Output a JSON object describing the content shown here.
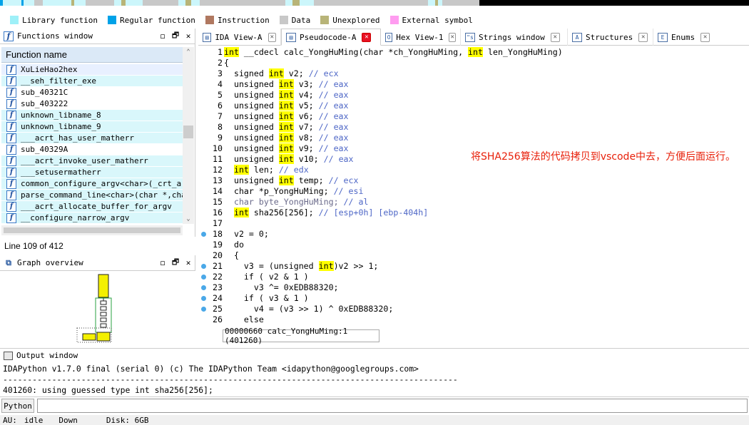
{
  "legend": [
    {
      "label": "Library function",
      "color": "#9ef0f8"
    },
    {
      "label": "Regular function",
      "color": "#00a2e8"
    },
    {
      "label": "Instruction",
      "color": "#b07860"
    },
    {
      "label": "Data",
      "color": "#c8c8c8"
    },
    {
      "label": "Unexplored",
      "color": "#b8b478"
    },
    {
      "label": "External symbol",
      "color": "#ff9cf0"
    }
  ],
  "functions_window": {
    "title": "Functions window",
    "column_header": "Function name",
    "items": [
      "XuLieHao2hex",
      "__seh_filter_exe",
      "sub_40321C",
      "sub_403222",
      "unknown_libname_8",
      "unknown_libname_9",
      "___acrt_has_user_matherr",
      "sub_40329A",
      "___acrt_invoke_user_matherr",
      "___setusermatherr",
      "common_configure_argv<char>(_crt_argv_",
      "parse_command_line<char>(char *,char *",
      "___acrt_allocate_buffer_for_argv",
      "__configure_narrow_argv"
    ],
    "line_info": "Line 109 of 412"
  },
  "graph_overview": {
    "title": "Graph overview"
  },
  "tabs": [
    {
      "label": "IDA View-A",
      "icon": "ida-view-icon"
    },
    {
      "label": "Pseudocode-A",
      "icon": "pseudocode-icon",
      "active": true
    },
    {
      "label": "Hex View-1",
      "icon": "hex-icon"
    },
    {
      "label": "Strings window",
      "icon": "strings-icon"
    },
    {
      "label": "Structures",
      "icon": "structures-icon"
    },
    {
      "label": "Enums",
      "icon": "enums-icon"
    }
  ],
  "code_lines": [
    {
      "n": "1",
      "html": "<span class=\"kw\">int</span> __cdecl calc_YongHuMing(char *ch_YongHuMing, <span class=\"kw\">int</span> len_YongHuMing)"
    },
    {
      "n": "2",
      "html": "{"
    },
    {
      "n": "3",
      "html": "  signed <span class=\"kw\">int</span> v2; <span class=\"cm\">// ecx</span>"
    },
    {
      "n": "4",
      "html": "  unsigned <span class=\"kw\">int</span> v3; <span class=\"cm\">// eax</span>"
    },
    {
      "n": "5",
      "html": "  unsigned <span class=\"kw\">int</span> v4; <span class=\"cm\">// eax</span>"
    },
    {
      "n": "6",
      "html": "  unsigned <span class=\"kw\">int</span> v5; <span class=\"cm\">// eax</span>"
    },
    {
      "n": "7",
      "html": "  unsigned <span class=\"kw\">int</span> v6; <span class=\"cm\">// eax</span>"
    },
    {
      "n": "8",
      "html": "  unsigned <span class=\"kw\">int</span> v7; <span class=\"cm\">// eax</span>"
    },
    {
      "n": "9",
      "html": "  unsigned <span class=\"kw\">int</span> v8; <span class=\"cm\">// eax</span>"
    },
    {
      "n": "10",
      "html": "  unsigned <span class=\"kw\">int</span> v9; <span class=\"cm\">// eax</span>"
    },
    {
      "n": "11",
      "html": "  unsigned <span class=\"kw\">int</span> v10; <span class=\"cm\">// eax</span>"
    },
    {
      "n": "12",
      "html": "  <span class=\"kw\">int</span> len; <span class=\"cm\">// edx</span>"
    },
    {
      "n": "13",
      "html": "  unsigned <span class=\"kw\">int</span> temp; <span class=\"cm\">// ecx</span>"
    },
    {
      "n": "14",
      "html": "  char *p_YongHuMing; <span class=\"cm\">// esi</span>"
    },
    {
      "n": "15",
      "html": "  <span class=\"dim\">char byte_YongHuMing;</span> <span class=\"cm\">// al</span>"
    },
    {
      "n": "16",
      "html": "  <span class=\"kw\">int</span> sha256[256]; <span class=\"cm\">// [esp+0h] [ebp-404h]</span>"
    },
    {
      "n": "17",
      "html": ""
    },
    {
      "n": "18",
      "html": "  v2 = 0;",
      "dot": true
    },
    {
      "n": "19",
      "html": "  do"
    },
    {
      "n": "20",
      "html": "  {"
    },
    {
      "n": "21",
      "html": "    v3 = (unsigned <span class=\"kw\">int</span>)v2 &gt;&gt; 1;",
      "dot": true
    },
    {
      "n": "22",
      "html": "    if ( v2 &amp; 1 )",
      "dot": true
    },
    {
      "n": "23",
      "html": "      v3 ^= 0xEDB88320;",
      "dot": true
    },
    {
      "n": "24",
      "html": "    if ( v3 &amp; 1 )",
      "dot": true
    },
    {
      "n": "25",
      "html": "      v4 = (v3 &gt;&gt; 1) ^ 0xEDB88320;",
      "dot": true
    },
    {
      "n": "26",
      "html": "    else"
    }
  ],
  "annotation": "将SHA256算法的代码拷贝到vscode中去，方便后面运行。",
  "code_status": "00000660 calc_YongHuMing:1 (401260)",
  "output_window": {
    "title": "Output window",
    "lines": [
      "IDAPython v1.7.0 final (serial 0) (c) The IDAPython Team <idapython@googlegroups.com>",
      "---------------------------------------------------------------------------------------------",
      "401260: using guessed type int sha256[256];"
    ],
    "python_button": "Python"
  },
  "statusbar": {
    "au": "AU:",
    "au_state": "idle",
    "direction": "Down",
    "disk": "Disk: 6GB"
  },
  "window_buttons": {
    "float": "◻",
    "restore": "🗗",
    "close": "✕"
  }
}
